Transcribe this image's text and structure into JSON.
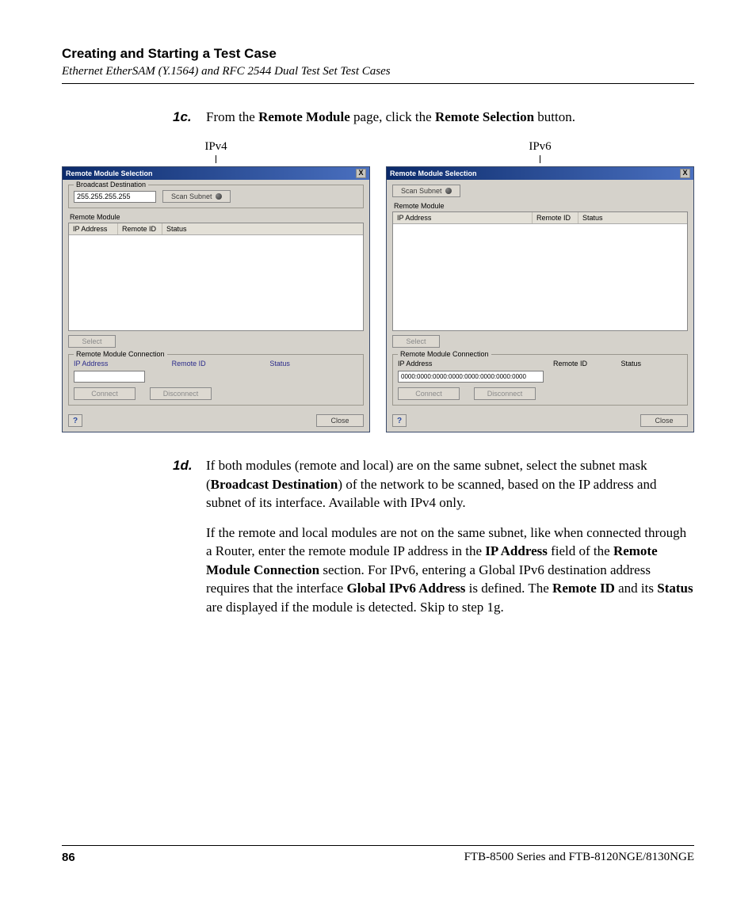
{
  "header": {
    "title": "Creating and Starting a Test Case",
    "subtitle": "Ethernet EtherSAM (Y.1564) and RFC 2544 Dual Test Set Test Cases"
  },
  "step1c": {
    "num": "1c.",
    "pre": "From the ",
    "b1": "Remote Module",
    "mid": " page, click the ",
    "b2": "Remote Selection",
    "post": " button."
  },
  "shots": {
    "ipv4_label": "IPv4",
    "ipv6_label": "IPv6",
    "dlg_title": "Remote Module Selection",
    "close_x": "X",
    "broadcast_legend": "Broadcast Destination",
    "broadcast_value": "255.255.255.255",
    "scan_btn": "Scan Subnet",
    "remote_module_label": "Remote Module",
    "col_ip": "IP Address",
    "col_remote_id": "Remote ID",
    "col_status": "Status",
    "select_btn": "Select",
    "conn_legend": "Remote Module Connection",
    "conn_ip": "IP Address",
    "conn_rid": "Remote ID",
    "conn_status": "Status",
    "ipv6_addr": "0000:0000:0000:0000:0000:0000:0000:0000",
    "connect": "Connect",
    "disconnect": "Disconnect",
    "help": "?",
    "close": "Close"
  },
  "step1d": {
    "num": "1d.",
    "p1_pre": "If both modules (remote and local) are on the same subnet, select the subnet mask (",
    "p1_b1": "Broadcast Destination",
    "p1_post": ") of the network to be scanned, based on the IP address and subnet of its interface. Available with IPv4 only.",
    "p2_pre": "If the remote and local modules are not on the same subnet, like when connected through a Router, enter the remote module IP address in the ",
    "p2_b1": "IP Address",
    "p2_mid1": " field of the ",
    "p2_b2": "Remote Module Connection",
    "p2_mid2": " section. For IPv6, entering a Global IPv6 destination address requires that the interface ",
    "p2_b3": "Global IPv6 Address",
    "p2_mid3": " is defined. The ",
    "p2_b4": "Remote ID",
    "p2_mid4": " and its ",
    "p2_b5": "Status",
    "p2_post": " are displayed if the module is detected. Skip to step 1g."
  },
  "footer": {
    "page": "86",
    "product": "FTB-8500 Series and FTB-8120NGE/8130NGE"
  }
}
